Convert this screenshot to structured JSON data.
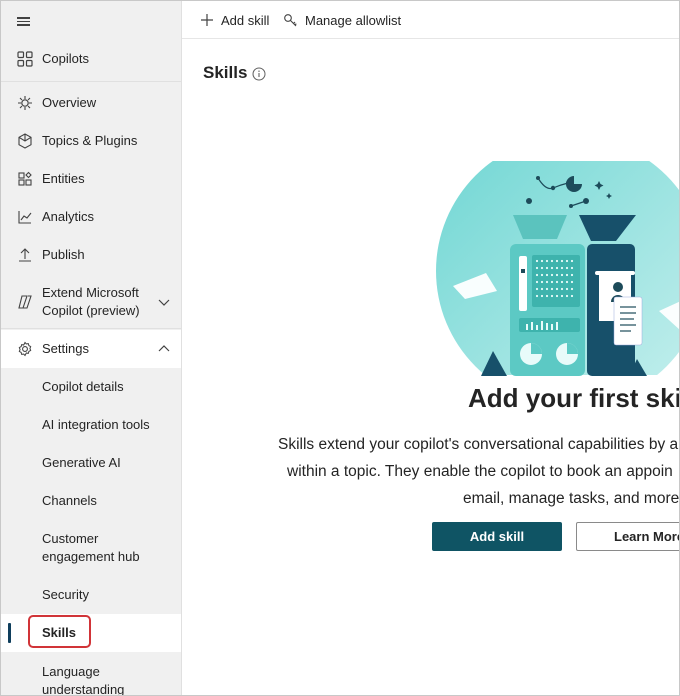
{
  "sidebar": {
    "top": {
      "label": "Copilots"
    },
    "items": [
      {
        "label": "Overview"
      },
      {
        "label": "Topics & Plugins"
      },
      {
        "label": "Entities"
      },
      {
        "label": "Analytics"
      },
      {
        "label": "Publish"
      },
      {
        "label": "Extend Microsoft Copilot (preview)"
      },
      {
        "label": "Settings"
      }
    ],
    "extend_line1": "Extend Microsoft",
    "extend_line2": "Copilot (preview)",
    "settings_sub": [
      {
        "label": "Copilot details"
      },
      {
        "label": "AI integration tools"
      },
      {
        "label": "Generative AI"
      },
      {
        "label": "Channels"
      },
      {
        "label": "Security"
      },
      {
        "label": "Skills"
      }
    ],
    "customer_line1": "Customer",
    "customer_line2": "engagement hub",
    "language_line1": "Language",
    "language_line2": "understanding"
  },
  "toolbar": {
    "add_skill": "Add skill",
    "manage_allowlist": "Manage allowlist"
  },
  "page": {
    "title": "Skills"
  },
  "empty_state": {
    "title": "Add your first skill",
    "text_line1": "Skills extend your copilot's conversational capabilities by a",
    "text_line2": "within a topic. They enable the copilot to book an appoin",
    "text_line3": "email, manage tasks, and more",
    "add_button": "Add skill",
    "learn_button": "Learn More"
  },
  "colors": {
    "accent": "#0f5464",
    "active_indicator": "#0f3e5c",
    "highlight": "#d13438"
  }
}
